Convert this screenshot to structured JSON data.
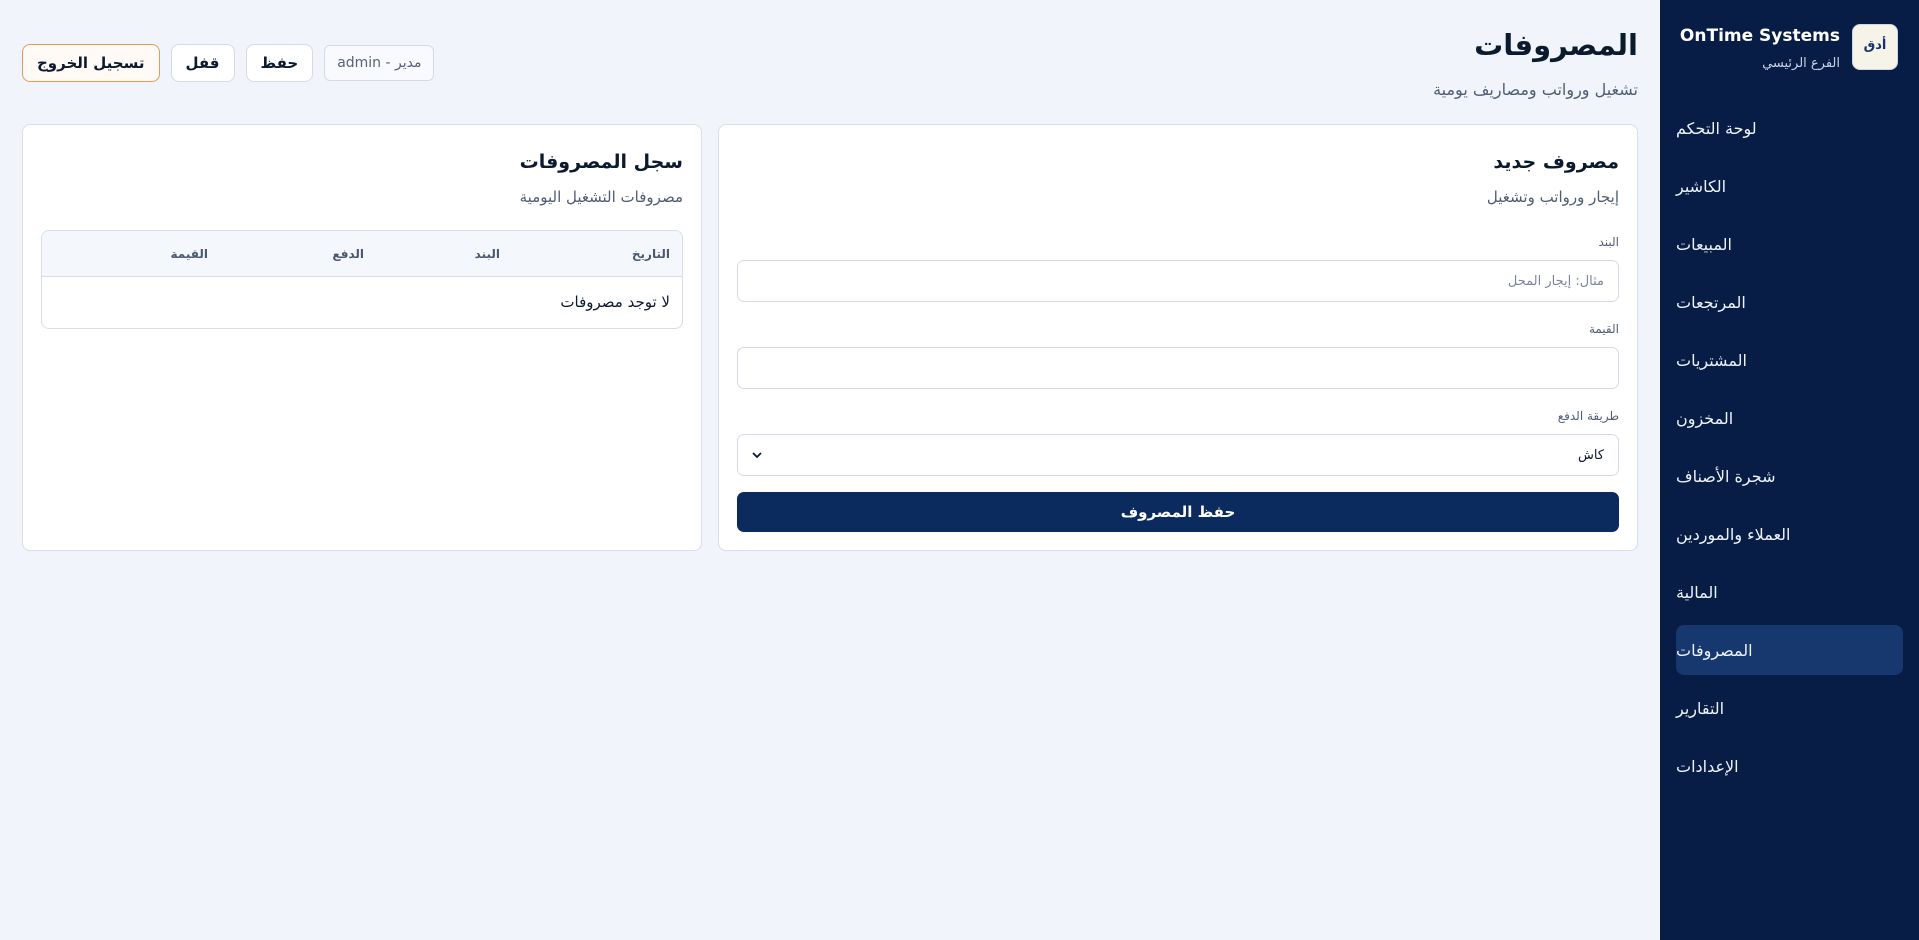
{
  "sidebar": {
    "brand_name": "OnTime Systems",
    "branch": "الفرع الرئيسي",
    "logo_text": "أدق",
    "logo_sub": "",
    "items": [
      {
        "label": "لوحة التحكم"
      },
      {
        "label": "الكاشير"
      },
      {
        "label": "المبيعات"
      },
      {
        "label": "المرتجعات"
      },
      {
        "label": "المشتريات"
      },
      {
        "label": "المخزون"
      },
      {
        "label": "شجرة الأصناف"
      },
      {
        "label": "العملاء والموردين"
      },
      {
        "label": "المالية"
      },
      {
        "label": "المصروفات",
        "active": true
      },
      {
        "label": "التقارير"
      },
      {
        "label": "الإعدادات"
      }
    ],
    "colors": {
      "background": "#071d45",
      "active": "#16386e"
    }
  },
  "header": {
    "title": "المصروفات",
    "subtitle": "تشغيل ورواتب ومصاريف يومية",
    "user": "admin - مدير",
    "save_label": "حفظ",
    "lock_label": "قفل",
    "logout_label": "تسجيل الخروج"
  },
  "new_expense": {
    "title": "مصروف جديد",
    "subtitle": "إيجار ورواتب وتشغيل",
    "item_label": "البند",
    "item_placeholder": "مثال: إيجار المحل",
    "item_value": "",
    "amount_label": "القيمة",
    "amount_value": "",
    "payment_label": "طريقة الدفع",
    "payment_value": "كاش",
    "submit_label": "حفظ المصروف",
    "accent": "#0b2a5e"
  },
  "expense_log": {
    "title": "سجل المصروفات",
    "subtitle": "مصروفات التشغيل اليومية",
    "columns": [
      "التاريخ",
      "البند",
      "الدفع",
      "القيمة"
    ],
    "empty_text": "لا توجد مصروفات"
  }
}
